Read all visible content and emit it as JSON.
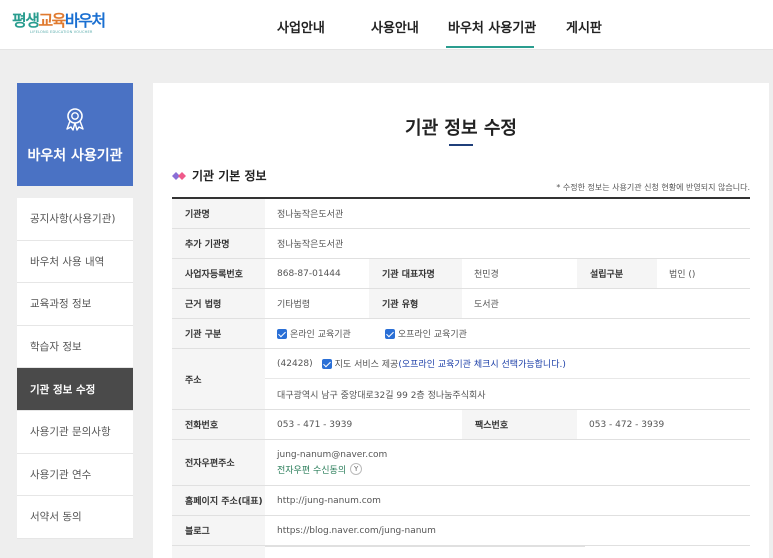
{
  "header": {
    "logo_text": "평생교육바우처",
    "logo_subtext": "LIFELONG EDUCATION VOUCHER",
    "nav": [
      {
        "label": "사업안내"
      },
      {
        "label": "사용안내"
      },
      {
        "label": "바우처 사용기관"
      },
      {
        "label": "게시판"
      }
    ],
    "active_nav": "바우처 사용기관",
    "accent_color": "#2a9d8f"
  },
  "sidebar": {
    "title": "바우처 사용기관",
    "icon": "award-ribbon-icon",
    "hero_color": "#4a72c4",
    "items": [
      {
        "label": "공지사항(사용기관)"
      },
      {
        "label": "바우처 사용 내역"
      },
      {
        "label": "교육과정 정보"
      },
      {
        "label": "학습자 정보"
      },
      {
        "label": "기관 정보 수정"
      },
      {
        "label": "사용기관 문의사항"
      },
      {
        "label": "사용기관 연수"
      },
      {
        "label": "서약서 동의"
      }
    ],
    "active_item": "기관 정보 수정"
  },
  "main": {
    "page_title": "기관 정보 수정",
    "section_title": "기관 기본 정보",
    "section_note": "* 수정한 정보는 사용기관 신청 현황에 반영되지 않습니다.",
    "fields": {
      "org_name": {
        "label": "기관명",
        "value": "정나눔작은도서관"
      },
      "extra_name": {
        "label": "추가 기관명",
        "value": "정나눔작은도서관"
      },
      "biz_no": {
        "label": "사업자등록번호",
        "value": "868-87-01444"
      },
      "rep_name": {
        "label": "기관 대표자명",
        "value": "천민경"
      },
      "est_type": {
        "label": "설립구분",
        "value": "법인 ()"
      },
      "basis_law": {
        "label": "근거 법령",
        "value": "기타법령"
      },
      "org_type": {
        "label": "기관 유형",
        "value": "도서관"
      },
      "category": {
        "label": "기관 구분",
        "online": "온라인 교육기관",
        "offline": "오프라인 교육기관"
      },
      "address": {
        "label": "주소",
        "zip": "(42428)",
        "map_service": "지도 서비스 제공",
        "map_note": "(오프라인 교육기관 체크시 선택가능합니다.)",
        "line": "대구광역시 남구 중앙대로32길 99 2층 정나눔주식회사"
      },
      "phone": {
        "label": "전화번호",
        "value": "053 - 471 - 3939"
      },
      "fax": {
        "label": "팩스번호",
        "value": "053 - 472 - 3939"
      },
      "email": {
        "label": "전자우편주소",
        "value": "jung-nanum@naver.com",
        "consent": "전자우편 수신동의",
        "consent_value": "Y"
      },
      "homepage": {
        "label": "홈페이지 주소(대표)",
        "value": "http://jung-nanum.com"
      },
      "blog": {
        "label": "블로그",
        "value": "https://blog.naver.com/jung-nanum"
      }
    }
  }
}
